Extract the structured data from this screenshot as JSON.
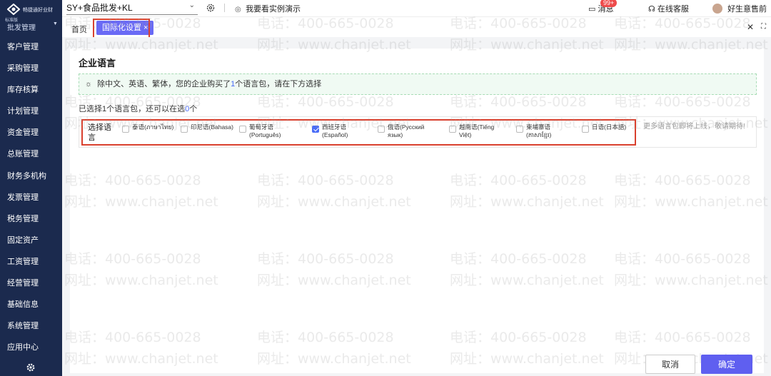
{
  "sidebar": {
    "brand": "畅捷通好业财",
    "edition": "标准版",
    "top_item": "批发管理",
    "items": [
      "客户管理",
      "采购管理",
      "库存核算",
      "计划管理",
      "资金管理",
      "总账管理",
      "财务多机构",
      "发票管理",
      "税务管理",
      "固定资产",
      "工资管理",
      "经营管理",
      "基础信息",
      "系统管理",
      "应用中心"
    ]
  },
  "topbar": {
    "account": "SY+食品批发+KL",
    "demo_link": "我要看实例演示",
    "messages_label": "消息",
    "messages_badge": "99+",
    "service_label": "在线客服",
    "user_name": "好生意售前"
  },
  "tabs": {
    "home": "首页",
    "active": "国际化设置 ×"
  },
  "page": {
    "title": "企业语言",
    "notice_prefix": "除中文、英语、繁体，您的企业购买了",
    "notice_count": "1",
    "notice_suffix": "个语言包，请在下方选择",
    "selected_prefix": "已选择1个语言包，还可以在选",
    "selected_count": "0",
    "selected_suffix": "个",
    "lang_label": "选择语言",
    "more_note": "更多语言包即将上线，敬请期待!",
    "languages": [
      {
        "label": "泰语(ภาษาไทย)",
        "checked": false
      },
      {
        "label": "印尼语(Bahasa)",
        "checked": false
      },
      {
        "label": "葡萄牙语(Português)",
        "checked": false
      },
      {
        "label": "西班牙语(Español)",
        "checked": true
      },
      {
        "label": "俄语(Русский язык)",
        "checked": false
      },
      {
        "label": "越南语(Tiếng Việt)",
        "checked": false
      },
      {
        "label": "柬埔寨语(ភាសាខ្មែរ)",
        "checked": false
      },
      {
        "label": "日语(日本語)",
        "checked": false
      }
    ]
  },
  "footer": {
    "cancel": "取消",
    "ok": "确定"
  },
  "watermark": {
    "phone": "电话：400-665-0028",
    "site": "网址：www.chanjet.net"
  },
  "colors": {
    "sidebar": "#1b2a4e",
    "accent": "#5f5ff0",
    "highlight": "#d9402e"
  }
}
